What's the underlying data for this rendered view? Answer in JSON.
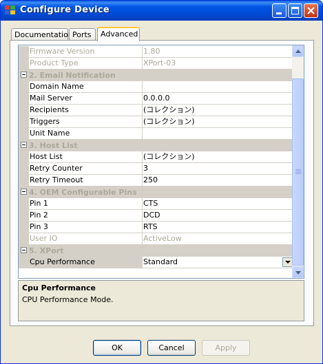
{
  "window": {
    "title": "Configure Device",
    "icon": "app-icon",
    "controls": [
      "minimize-icon",
      "maximize-icon",
      "close-icon"
    ]
  },
  "tabs": [
    {
      "label": "Documentation",
      "active": false
    },
    {
      "label": "Ports",
      "active": false
    },
    {
      "label": "Advanced",
      "active": true
    }
  ],
  "grid": {
    "rows": [
      {
        "type": "prop",
        "name": "Firmware Version",
        "value": "1.80",
        "disabled": true
      },
      {
        "type": "prop",
        "name": "Product Type",
        "value": "XPort-03",
        "disabled": true
      },
      {
        "type": "cat",
        "label": "2. Email Notification"
      },
      {
        "type": "prop",
        "name": "Domain Name",
        "value": ""
      },
      {
        "type": "prop",
        "name": "Mail Server",
        "value": "0.0.0.0"
      },
      {
        "type": "prop",
        "name": "Recipients",
        "value": "(コレクション)"
      },
      {
        "type": "prop",
        "name": "Triggers",
        "value": "(コレクション)"
      },
      {
        "type": "prop",
        "name": "Unit Name",
        "value": ""
      },
      {
        "type": "cat",
        "label": "3. Host List"
      },
      {
        "type": "prop",
        "name": "Host List",
        "value": "(コレクション)"
      },
      {
        "type": "prop",
        "name": "Retry Counter",
        "value": "3"
      },
      {
        "type": "prop",
        "name": "Retry Timeout",
        "value": "250"
      },
      {
        "type": "cat",
        "label": "4. OEM Configurable Pins"
      },
      {
        "type": "prop",
        "name": "Pin 1",
        "value": "CTS"
      },
      {
        "type": "prop",
        "name": "Pin 2",
        "value": "DCD"
      },
      {
        "type": "prop",
        "name": "Pin 3",
        "value": "RTS"
      },
      {
        "type": "prop",
        "name": "User IO",
        "value": "ActiveLow",
        "disabled": true
      },
      {
        "type": "cat",
        "label": "5. XPort"
      },
      {
        "type": "prop",
        "name": "Cpu Performance",
        "value": "Standard",
        "selected": true,
        "dropdown": true
      }
    ]
  },
  "help": {
    "title": "Cpu Performance",
    "description": "CPU Performance Mode."
  },
  "buttons": {
    "ok": "OK",
    "cancel": "Cancel",
    "apply": "Apply"
  }
}
